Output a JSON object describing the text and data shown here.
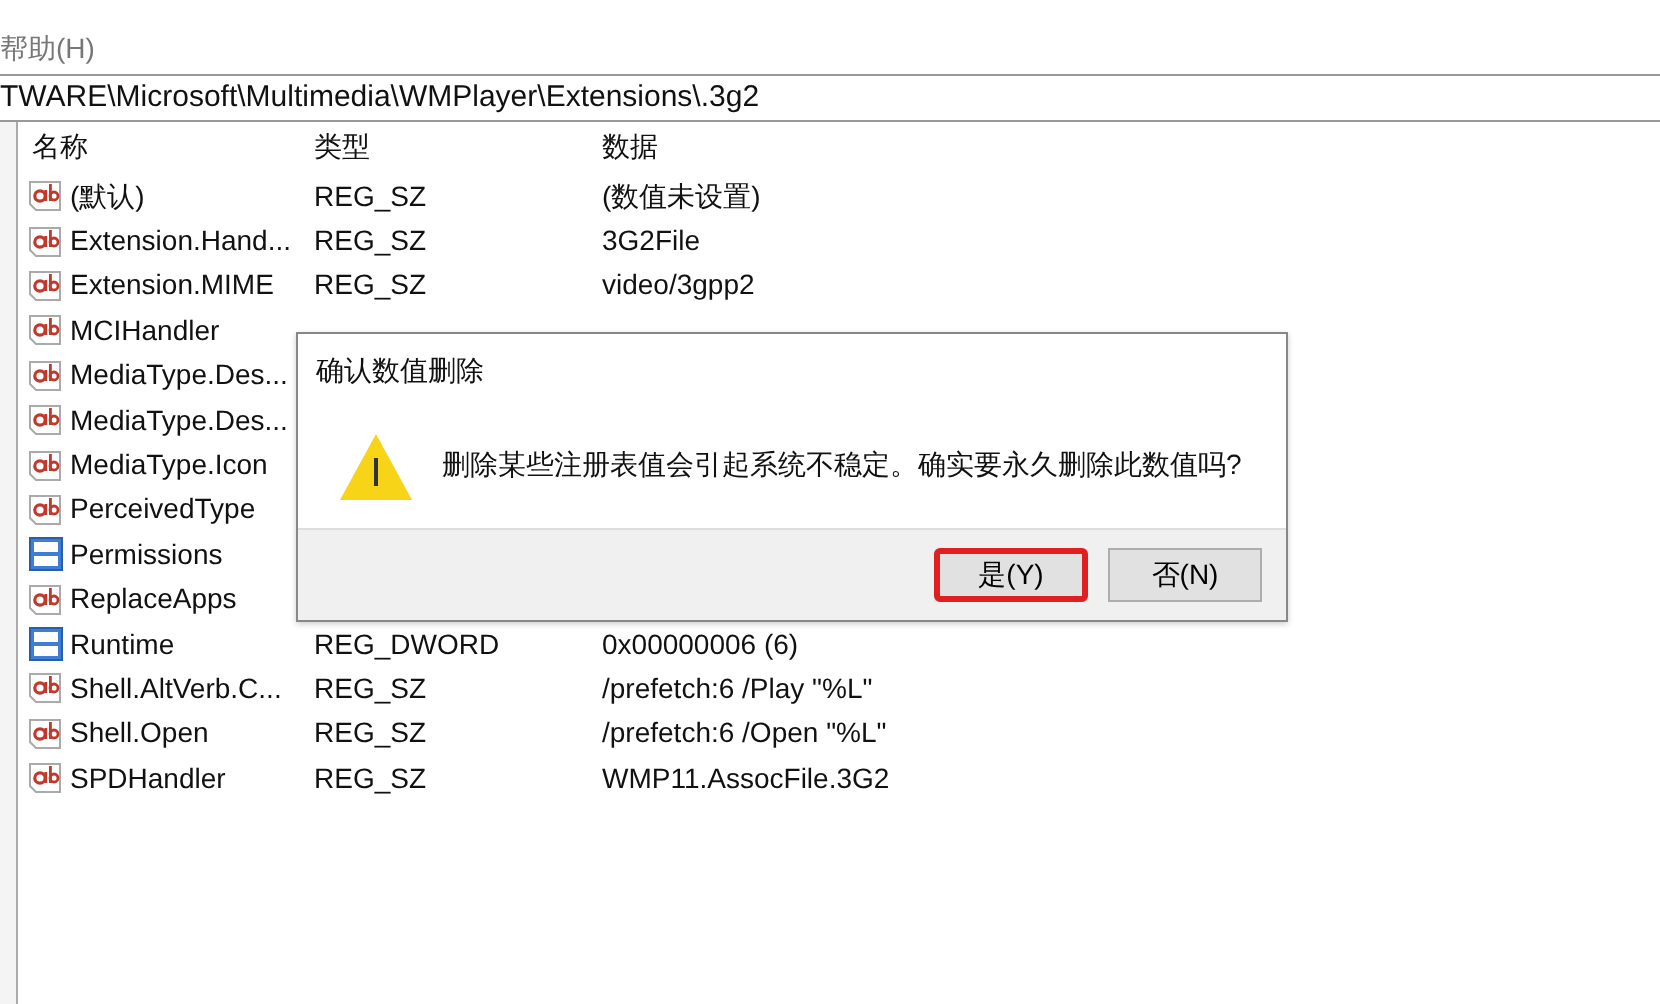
{
  "menu": {
    "label": "帮助(H)"
  },
  "address": "TWARE\\Microsoft\\Multimedia\\WMPlayer\\Extensions\\.3g2",
  "columns": [
    "名称",
    "类型",
    "数据"
  ],
  "rows": [
    {
      "kind": "string",
      "name": "(默认)",
      "type": "REG_SZ",
      "data": "(数值未设置)"
    },
    {
      "kind": "string",
      "name": "Extension.Hand...",
      "type": "REG_SZ",
      "data": "3G2File"
    },
    {
      "kind": "string",
      "name": "Extension.MIME",
      "type": "REG_SZ",
      "data": "video/3gpp2"
    },
    {
      "kind": "string",
      "name": "MCIHandler"
    },
    {
      "kind": "string",
      "name": "MediaType.Des..."
    },
    {
      "kind": "string",
      "name": "MediaType.Des..."
    },
    {
      "kind": "string",
      "name": "MediaType.Icon"
    },
    {
      "kind": "string",
      "name": "PerceivedType"
    },
    {
      "kind": "binary",
      "name": "Permissions"
    },
    {
      "kind": "string",
      "name": "ReplaceApps"
    },
    {
      "kind": "binary",
      "name": "Runtime",
      "type": "REG_DWORD",
      "data": "0x00000006 (6)"
    },
    {
      "kind": "string",
      "name": "Shell.AltVerb.C...",
      "type": "REG_SZ",
      "data": "/prefetch:6 /Play \"%L\""
    },
    {
      "kind": "string",
      "name": "Shell.Open",
      "type": "REG_SZ",
      "data": "/prefetch:6 /Open \"%L\""
    },
    {
      "kind": "string",
      "name": "SPDHandler",
      "type": "REG_SZ",
      "data": "WMP11.AssocFile.3G2"
    }
  ],
  "dialog": {
    "title": "确认数值删除",
    "message": "删除某些注册表值会引起系统不稳定。确实要永久删除此数值吗?",
    "buttons": [
      {
        "label": "是(Y)",
        "highlighted": true
      },
      {
        "label": "否(N)",
        "highlighted": false
      }
    ]
  }
}
